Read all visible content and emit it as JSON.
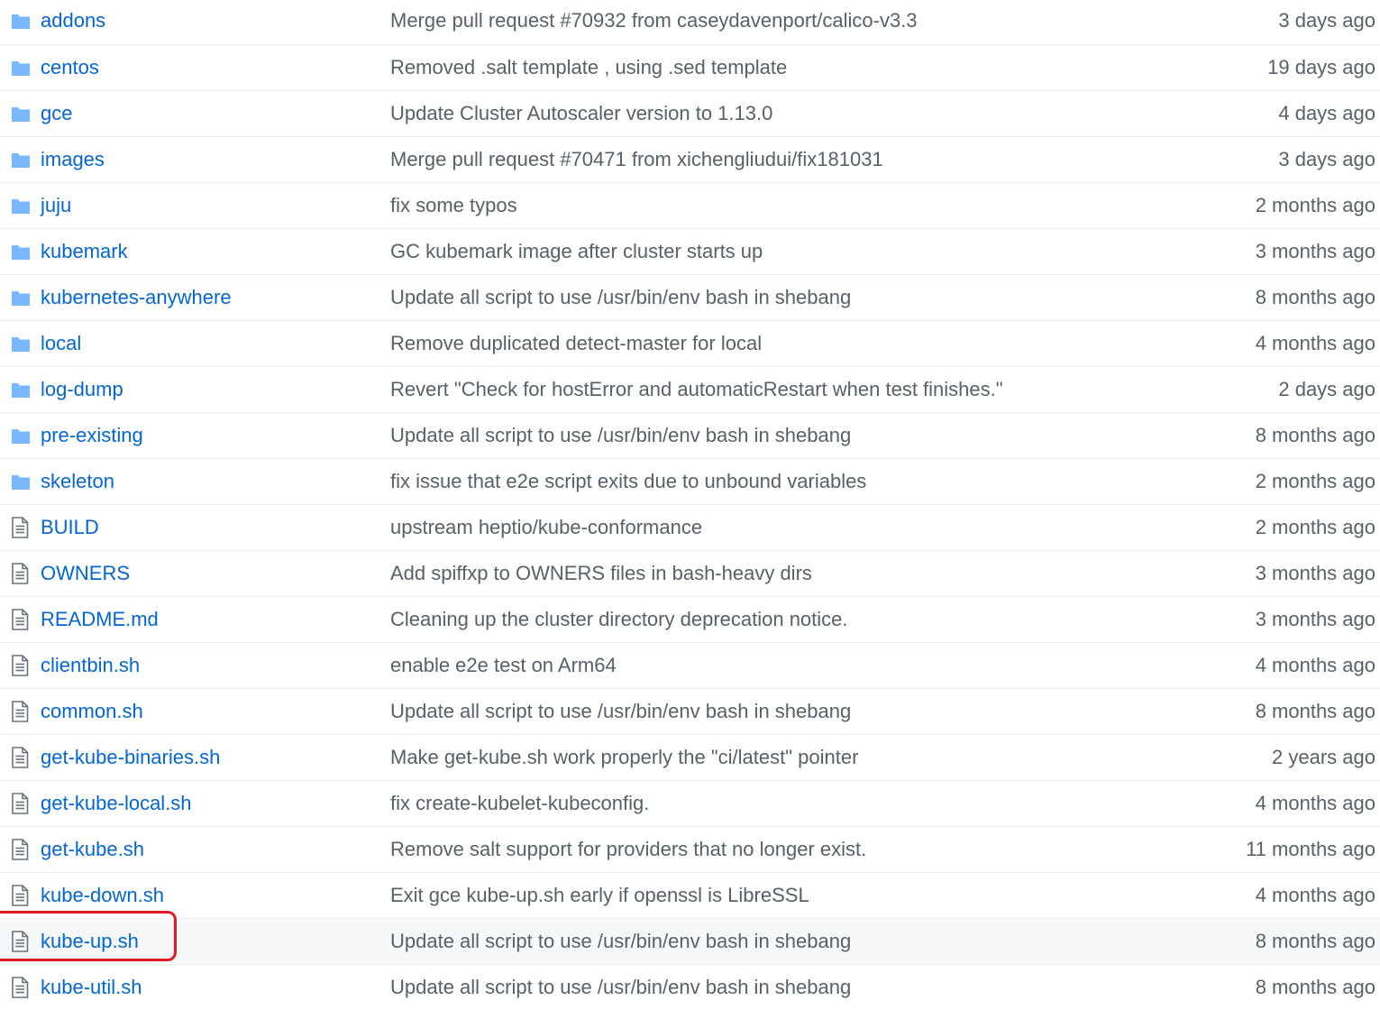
{
  "colors": {
    "link": "#0366d6",
    "muted": "#586069",
    "folder_icon": "#79b8ff",
    "highlight_ring": "#e01b24"
  },
  "highlighted": "kube-up.sh",
  "rows": [
    {
      "name": "addons",
      "type": "folder",
      "icon": "folder-icon",
      "message": "Merge pull request #70932 from caseydavenport/calico-v3.3",
      "age": "3 days ago"
    },
    {
      "name": "centos",
      "type": "folder",
      "icon": "folder-icon",
      "message": "Removed .salt template , using .sed template",
      "age": "19 days ago"
    },
    {
      "name": "gce",
      "type": "folder",
      "icon": "folder-icon",
      "message": "Update Cluster Autoscaler version to 1.13.0",
      "age": "4 days ago"
    },
    {
      "name": "images",
      "type": "folder",
      "icon": "folder-icon",
      "message": "Merge pull request #70471 from xichengliudui/fix181031",
      "age": "3 days ago"
    },
    {
      "name": "juju",
      "type": "folder",
      "icon": "folder-icon",
      "message": "fix some typos",
      "age": "2 months ago"
    },
    {
      "name": "kubemark",
      "type": "folder",
      "icon": "folder-icon",
      "message": "GC kubemark image after cluster starts up",
      "age": "3 months ago"
    },
    {
      "name": "kubernetes-anywhere",
      "type": "folder",
      "icon": "folder-icon",
      "message": "Update all script to use /usr/bin/env bash in shebang",
      "age": "8 months ago"
    },
    {
      "name": "local",
      "type": "folder",
      "icon": "folder-icon",
      "message": "Remove duplicated detect-master for local",
      "age": "4 months ago"
    },
    {
      "name": "log-dump",
      "type": "folder",
      "icon": "folder-icon",
      "message": "Revert \"Check for hostError and automaticRestart when test finishes.\"",
      "age": "2 days ago"
    },
    {
      "name": "pre-existing",
      "type": "folder",
      "icon": "folder-icon",
      "message": "Update all script to use /usr/bin/env bash in shebang",
      "age": "8 months ago"
    },
    {
      "name": "skeleton",
      "type": "folder",
      "icon": "folder-icon",
      "message": "fix issue that e2e script exits due to unbound variables",
      "age": "2 months ago"
    },
    {
      "name": "BUILD",
      "type": "file",
      "icon": "file-icon",
      "message": "upstream heptio/kube-conformance",
      "age": "2 months ago"
    },
    {
      "name": "OWNERS",
      "type": "file",
      "icon": "file-icon",
      "message": "Add spiffxp to OWNERS files in bash-heavy dirs",
      "age": "3 months ago"
    },
    {
      "name": "README.md",
      "type": "file",
      "icon": "file-icon",
      "message": "Cleaning up the cluster directory deprecation notice.",
      "age": "3 months ago"
    },
    {
      "name": "clientbin.sh",
      "type": "file",
      "icon": "file-icon",
      "message": "enable e2e test on Arm64",
      "age": "4 months ago"
    },
    {
      "name": "common.sh",
      "type": "file",
      "icon": "file-icon",
      "message": "Update all script to use /usr/bin/env bash in shebang",
      "age": "8 months ago"
    },
    {
      "name": "get-kube-binaries.sh",
      "type": "file",
      "icon": "file-icon",
      "message": "Make get-kube.sh work properly the \"ci/latest\" pointer",
      "age": "2 years ago"
    },
    {
      "name": "get-kube-local.sh",
      "type": "file",
      "icon": "file-icon",
      "message": "fix create-kubelet-kubeconfig.",
      "age": "4 months ago"
    },
    {
      "name": "get-kube.sh",
      "type": "file",
      "icon": "file-icon",
      "message": "Remove salt support for providers that no longer exist.",
      "age": "11 months ago"
    },
    {
      "name": "kube-down.sh",
      "type": "file",
      "icon": "file-icon",
      "message": "Exit gce kube-up.sh early if openssl is LibreSSL",
      "age": "4 months ago"
    },
    {
      "name": "kube-up.sh",
      "type": "file",
      "icon": "file-icon",
      "message": "Update all script to use /usr/bin/env bash in shebang",
      "age": "8 months ago"
    },
    {
      "name": "kube-util.sh",
      "type": "file",
      "icon": "file-icon",
      "message": "Update all script to use /usr/bin/env bash in shebang",
      "age": "8 months ago"
    }
  ]
}
